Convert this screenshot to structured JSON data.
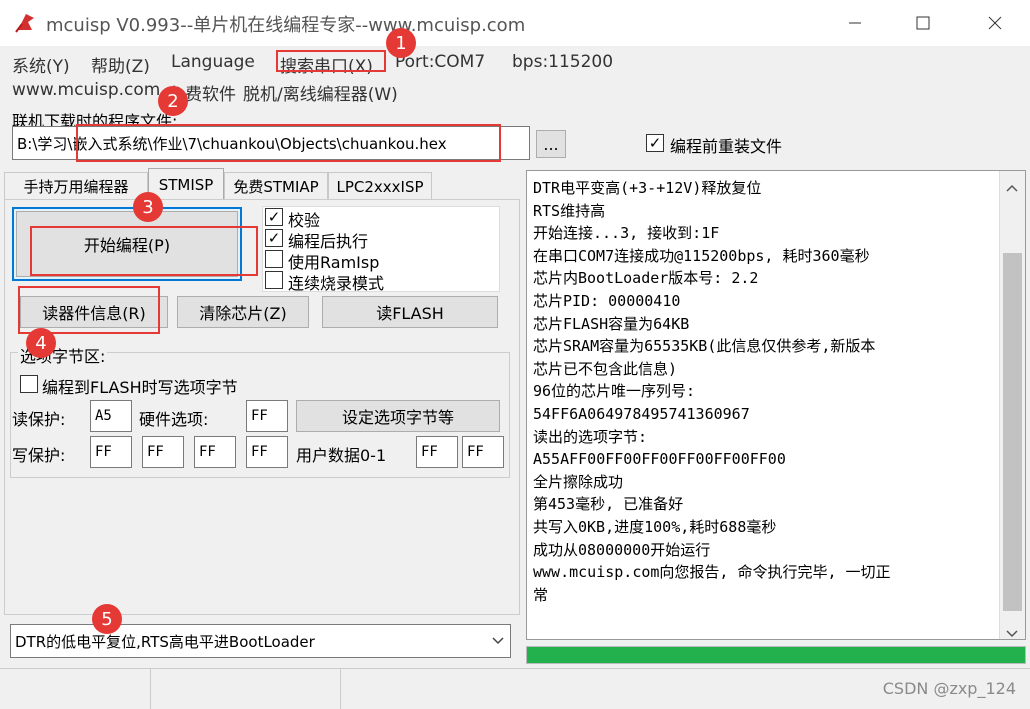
{
  "window": {
    "title": "mcuisp V0.993--单片机在线编程专家--www.mcuisp.com"
  },
  "menu": {
    "system": "系统(Y)",
    "help": "帮助(Z)",
    "language": "Language",
    "search_port": "搜索串口(X)",
    "port": "Port:COM7",
    "bps": "bps:115200",
    "website": "www.mcuisp.com",
    "free_software": "免费软件",
    "offline": "脱机/离线编程器(W)"
  },
  "file": {
    "label": "联机下载时的程序文件:",
    "path": "B:\\学习\\嵌入式系统\\作业\\7\\chuankou\\Objects\\chuankou.hex",
    "browse": "...",
    "reload_label": "编程前重装文件",
    "reload_checked": true
  },
  "tabs": [
    {
      "label": "手持万用编程器"
    },
    {
      "label": "STMISP"
    },
    {
      "label": "免费STMIAP"
    },
    {
      "label": "LPC2xxxISP"
    }
  ],
  "program": {
    "start": "开始编程(P)",
    "options": [
      {
        "label": "校验",
        "checked": true
      },
      {
        "label": "编程后执行",
        "checked": true
      },
      {
        "label": "使用RamIsp",
        "checked": false
      },
      {
        "label": "连续烧录模式",
        "checked": false
      }
    ],
    "read_info": "读器件信息(R)",
    "erase": "清除芯片(Z)",
    "read_flash": "读FLASH"
  },
  "option_bytes": {
    "group_label": "选项字节区:",
    "write_opt_label": "编程到FLASH时写选项字节",
    "write_opt_checked": false,
    "read_protect_label": "读保护:",
    "read_protect": "A5",
    "hw_option_label": "硬件选项:",
    "hw_option": "FF",
    "set_button": "设定选项字节等",
    "write_protect_label": "写保护:",
    "write_protect": [
      "FF",
      "FF",
      "FF",
      "FF"
    ],
    "user_data_label": "用户数据0-1",
    "user_data": [
      "FF",
      "FF"
    ]
  },
  "mode": {
    "selected": "DTR的低电平复位,RTS高电平进BootLoader"
  },
  "log": [
    "DTR电平变高(+3-+12V)释放复位",
    "RTS维持高",
    "开始连接...3, 接收到:1F",
    "在串口COM7连接成功@115200bps, 耗时360毫秒",
    "芯片内BootLoader版本号: 2.2",
    "芯片PID: 00000410",
    "芯片FLASH容量为64KB",
    "芯片SRAM容量为65535KB(此信息仅供参考,新版本",
    "芯片已不包含此信息)",
    "96位的芯片唯一序列号:",
    "54FF6A064978495741360967",
    "读出的选项字节:",
    "A55AFF00FF00FF00FF00FF00FF00",
    "全片擦除成功",
    "第453毫秒, 已准备好",
    "共写入0KB,进度100%,耗时688毫秒",
    "成功从08000000开始运行",
    "www.mcuisp.com向您报告, 命令执行完毕, 一切正",
    "常"
  ],
  "progress": {
    "percent": 100,
    "color": "#22b14c"
  },
  "badges": [
    "1",
    "2",
    "3",
    "4",
    "5"
  ],
  "watermark": "CSDN @zxp_124",
  "colors": {
    "annotation": "#e53935",
    "progress": "#22b14c",
    "focus": "#0078d7"
  }
}
